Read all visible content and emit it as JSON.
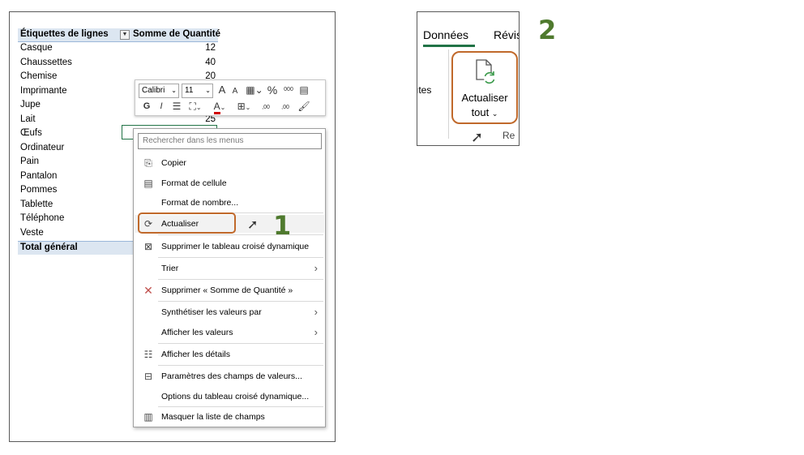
{
  "pivot": {
    "header_row_labels": "Étiquettes de lignes",
    "header_value": "Somme de Quantité",
    "rows": [
      {
        "label": "Casque",
        "value": "12"
      },
      {
        "label": "Chaussettes",
        "value": "40"
      },
      {
        "label": "Chemise",
        "value": "20"
      },
      {
        "label": "Imprimante",
        "value": ""
      },
      {
        "label": "Jupe",
        "value": ""
      },
      {
        "label": "Lait",
        "value": "25"
      },
      {
        "label": "Œufs",
        "value": ""
      },
      {
        "label": "Ordinateur",
        "value": ""
      },
      {
        "label": "Pain",
        "value": ""
      },
      {
        "label": "Pantalon",
        "value": ""
      },
      {
        "label": "Pommes",
        "value": ""
      },
      {
        "label": "Tablette",
        "value": ""
      },
      {
        "label": "Téléphone",
        "value": ""
      },
      {
        "label": "Veste",
        "value": ""
      }
    ],
    "total_label": "Total général"
  },
  "mini_toolbar": {
    "font_name": "Calibri",
    "font_size": "11",
    "bold": "G",
    "italic": "I",
    "grow_font": "A",
    "shrink_font": "A",
    "percent": "%",
    "thousands": "000",
    "decimal_increase": ",00",
    "decimal_decrease": ",00"
  },
  "context_menu": {
    "search_placeholder": "Rechercher dans les menus",
    "items": [
      {
        "label": "Copier",
        "icon": "copy-icon"
      },
      {
        "label": "Format de cellule",
        "icon": "format-cells-icon"
      },
      {
        "label": "Format de nombre...",
        "icon": ""
      },
      {
        "label": "Actualiser",
        "icon": "refresh-icon"
      },
      {
        "label": "Supprimer le tableau croisé dynamique",
        "icon": "delete-pivot-icon"
      },
      {
        "label": "Trier",
        "icon": "",
        "submenu": true
      },
      {
        "label": "Supprimer « Somme de Quantité »",
        "icon": "close-icon"
      },
      {
        "label": "Synthétiser les valeurs par",
        "icon": "",
        "submenu": true
      },
      {
        "label": "Afficher les valeurs",
        "icon": "",
        "submenu": true
      },
      {
        "label": "Afficher les détails",
        "icon": "details-icon"
      },
      {
        "label": "Paramètres des champs de valeurs...",
        "icon": "field-settings-icon"
      },
      {
        "label": "Options du tableau croisé dynamique...",
        "icon": ""
      },
      {
        "label": "Masquer la liste de champs",
        "icon": "field-list-icon"
      }
    ]
  },
  "callouts": {
    "step1": "1",
    "step2": "2"
  },
  "ribbon": {
    "tab_donnees": "Données",
    "tab_revision": "Révis",
    "partial_left": "ıtes",
    "refresh_all_line1": "Actualiser",
    "refresh_all_line2": "tout",
    "group_partial": "Re"
  },
  "colors": {
    "highlight_orange": "#c0692b",
    "callout_green": "#4f7a2e",
    "pivot_header_bg": "#dce6f1",
    "excel_green": "#217346"
  }
}
